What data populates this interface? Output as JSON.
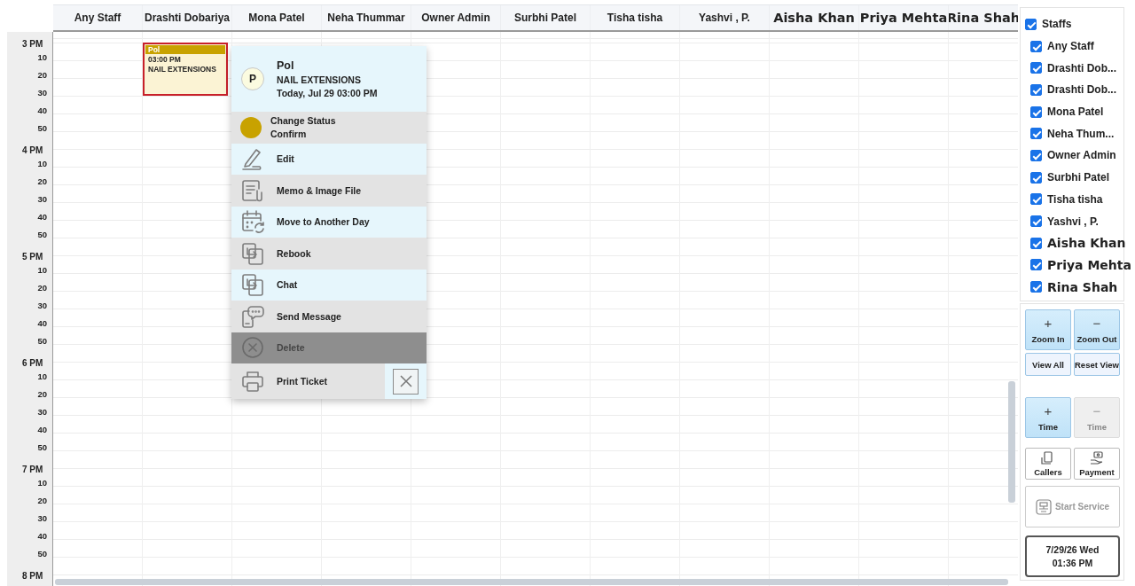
{
  "columns": [
    {
      "name": "Any Staff",
      "kind": "regular"
    },
    {
      "name": "Drashti Dobariya",
      "kind": "regular"
    },
    {
      "name": "Mona  Patel",
      "kind": "regular"
    },
    {
      "name": "Neha  Thummar",
      "kind": "regular"
    },
    {
      "name": "Owner Admin",
      "kind": "regular"
    },
    {
      "name": "Surbhi  Patel",
      "kind": "regular"
    },
    {
      "name": "Tisha tisha",
      "kind": "regular"
    },
    {
      "name": "Yashvi , P.",
      "kind": "regular"
    },
    {
      "name": "Aisha Khan",
      "kind": "large"
    },
    {
      "name": "Priya Mehta",
      "kind": "large"
    },
    {
      "name": "Rina Shah",
      "kind": "large"
    }
  ],
  "time_slots": [
    {
      "hour": "3 PM",
      "minutes": [
        "10",
        "20",
        "30",
        "40",
        "50"
      ]
    },
    {
      "hour": "4 PM",
      "minutes": [
        "10",
        "20",
        "30",
        "40",
        "50"
      ]
    },
    {
      "hour": "5 PM",
      "minutes": [
        "10",
        "20",
        "30",
        "40",
        "50"
      ]
    },
    {
      "hour": "6 PM",
      "minutes": [
        "10",
        "20",
        "30",
        "40",
        "50"
      ]
    },
    {
      "hour": "7 PM",
      "minutes": [
        "10",
        "20",
        "30",
        "40",
        "50"
      ]
    },
    {
      "hour": "8 PM"
    }
  ],
  "appointment": {
    "client": "Pol",
    "time": "03:00 PM",
    "service": "NAIL EXTENSIONS"
  },
  "popup": {
    "avatar": "P",
    "client": "Pol",
    "service": "NAIL EXTENSIONS",
    "when": "Today, Jul 29 03:00 PM",
    "items": [
      {
        "kind": "status",
        "label": "Change Status",
        "value": "Confirm",
        "color": "#c8a200"
      },
      {
        "kind": "action",
        "label": "Edit",
        "disabled": false
      },
      {
        "kind": "action",
        "label": "Memo & Image File",
        "disabled": false
      },
      {
        "kind": "action",
        "label": "Move to Another Day",
        "disabled": false
      },
      {
        "kind": "action",
        "label": "Rebook",
        "disabled": false
      },
      {
        "kind": "action",
        "label": "Chat",
        "disabled": false
      },
      {
        "kind": "action",
        "label": "Send Message",
        "disabled": false
      },
      {
        "kind": "action",
        "label": "Delete",
        "disabled": true
      },
      {
        "kind": "action",
        "label": "Print Ticket",
        "disabled": false
      }
    ]
  },
  "staff_filter": {
    "title": "Staffs",
    "checked": true,
    "items": [
      {
        "label": "Any Staff",
        "checked": true,
        "kind": "regular"
      },
      {
        "label": "Drashti Dob...",
        "checked": true,
        "kind": "regular"
      },
      {
        "label": "Drashti Dob...",
        "checked": true,
        "kind": "regular"
      },
      {
        "label": "Mona  Patel",
        "checked": true,
        "kind": "regular"
      },
      {
        "label": "Neha  Thum...",
        "checked": true,
        "kind": "regular"
      },
      {
        "label": "Owner Admin",
        "checked": true,
        "kind": "regular"
      },
      {
        "label": "Surbhi  Patel",
        "checked": true,
        "kind": "regular"
      },
      {
        "label": "Tisha tisha",
        "checked": true,
        "kind": "regular"
      },
      {
        "label": "Yashvi , P.",
        "checked": true,
        "kind": "regular"
      },
      {
        "label": "Aisha Khan",
        "checked": true,
        "kind": "large"
      },
      {
        "label": "Priya Mehta",
        "checked": true,
        "kind": "large"
      },
      {
        "label": "Rina Shah",
        "checked": true,
        "kind": "large"
      }
    ]
  },
  "controls": {
    "zoom": [
      {
        "symbol": "+",
        "label": "Zoom In"
      },
      {
        "symbol": "−",
        "label": "Zoom Out"
      }
    ],
    "view": [
      "View All",
      "Reset View"
    ],
    "time": [
      {
        "symbol": "+",
        "label": "Time",
        "disabled": false
      },
      {
        "symbol": "−",
        "label": "Time",
        "disabled": true
      }
    ],
    "tools": [
      "Callers",
      "Payment"
    ],
    "start_service": {
      "label": "Start Service",
      "disabled": true
    },
    "clock": {
      "date": "7/29/26 Wed",
      "time": "01:36 PM"
    }
  }
}
